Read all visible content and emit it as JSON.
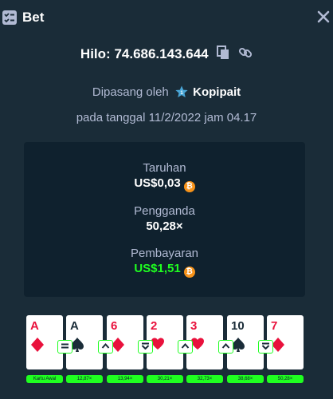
{
  "header": {
    "title": "Bet",
    "icon": "bet-slip-icon"
  },
  "bet": {
    "game": "Hilo:",
    "id": "74.686.143.644",
    "placed_by_prefix": "Dipasang oleh",
    "user": "Kopipait",
    "date_line": "pada tanggal 11/2/2022 jam 04.17"
  },
  "stats": {
    "wager_label": "Taruhan",
    "wager_value": "US$0,03",
    "multiplier_label": "Pengganda",
    "multiplier_value": "50,28×",
    "payout_label": "Pembayaran",
    "payout_value": "US$1,51",
    "currency_symbol": "₿",
    "payout_color": "#1fff20"
  },
  "cards": [
    {
      "rank": "A",
      "suit": "diamond",
      "color": "red",
      "guess": "",
      "label": "Kartu Awal"
    },
    {
      "rank": "A",
      "suit": "spade",
      "color": "black",
      "guess": "equal",
      "label": "12,87×"
    },
    {
      "rank": "6",
      "suit": "diamond",
      "color": "red",
      "guess": "higher",
      "label": "13,94×"
    },
    {
      "rank": "2",
      "suit": "heart",
      "color": "red",
      "guess": "lower",
      "label": "30,21×"
    },
    {
      "rank": "3",
      "suit": "heart",
      "color": "red",
      "guess": "higher",
      "label": "32,73×"
    },
    {
      "rank": "10",
      "suit": "spade",
      "color": "black",
      "guess": "higher",
      "label": "38,68×"
    },
    {
      "rank": "7",
      "suit": "diamond",
      "color": "red",
      "guess": "lower",
      "label": "50,28×"
    }
  ]
}
